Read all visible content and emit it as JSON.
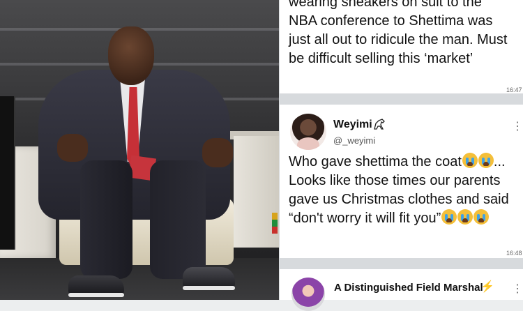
{
  "tweets": [
    {
      "text": "wearing sneakers on suit to the NBA conference to Shettima was just all out to ridicule the man. Must be difficult selling this ‘market’",
      "time": "16:47"
    },
    {
      "author": "Weyimi",
      "handle": "@_weyimi",
      "text_parts": [
        "Who gave shettima the coat",
        "... Looks like those times our parents gave us Christmas clothes and said “don't worry it will fit you”"
      ],
      "time": "16:48"
    },
    {
      "author": "A Distinguished Field Marshal",
      "author_emoji": "⚡"
    }
  ],
  "icons": {
    "more": "more-vertical-icon",
    "crying_emoji": "loudly-crying-face-emoji",
    "badge": "horse-badge-icon"
  },
  "colors": {
    "card_bg": "#ffffff",
    "panel_bg": "#d7dadd",
    "text": "#111111",
    "handle": "#555555",
    "bolt": "#f0b400"
  }
}
